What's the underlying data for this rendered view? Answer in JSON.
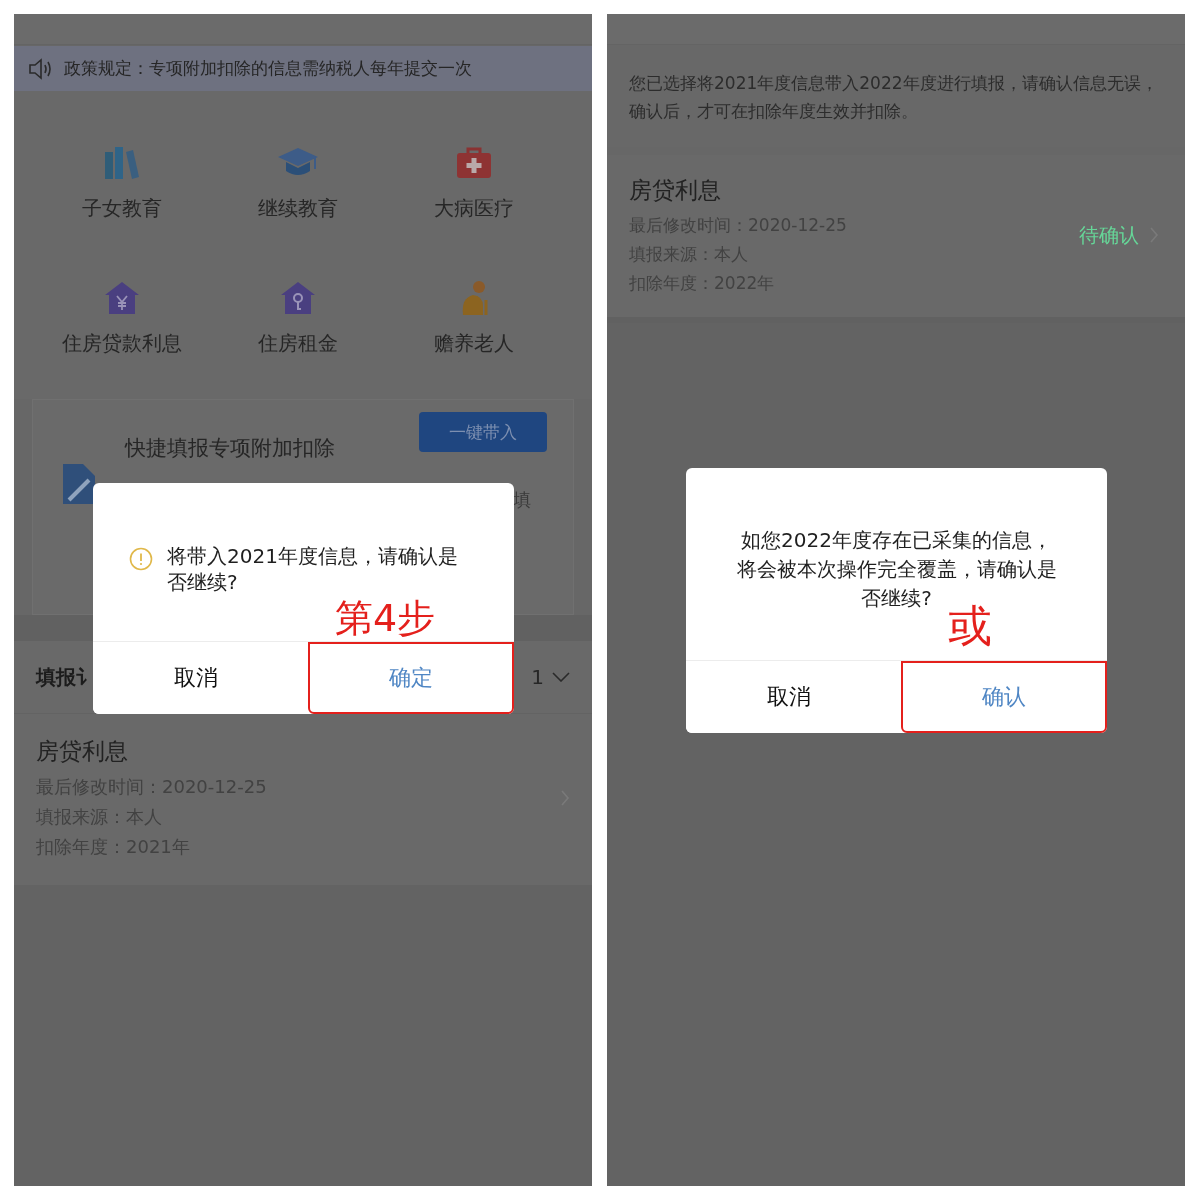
{
  "screen_1": {
    "notice": "政策规定：专项附加扣除的信息需纳税人每年提交一次",
    "categories": [
      {
        "label": "子女教育"
      },
      {
        "label": "继续教育"
      },
      {
        "label": "大病医疗"
      },
      {
        "label": "住房贷款利息"
      },
      {
        "label": "住房租金"
      },
      {
        "label": "赡养老人"
      }
    ],
    "quick_fill": {
      "title": "快捷填报专项附加扣除",
      "button": "一键带入",
      "hint": "填"
    },
    "records_header": {
      "title": "填报讠",
      "year": "1"
    },
    "record": {
      "title": "房贷利息",
      "lines": [
        "最后修改时间：2020-12-25",
        "填报来源：本人",
        "扣除年度：2021年"
      ]
    },
    "dialog": {
      "kind": "warning",
      "message": "将带入2021年度信息，请确认是否继续?",
      "annotation": "第4步",
      "buttons": [
        {
          "label": "取消",
          "primary": false,
          "highlighted": false
        },
        {
          "label": "确定",
          "primary": true,
          "highlighted": true
        }
      ]
    }
  },
  "screen_2": {
    "notice": "您已选择将2021年度信息带入2022年度进行填报，请确认信息无误，确认后，才可在扣除年度生效并扣除。",
    "record": {
      "title": "房贷利息",
      "lines": [
        "最后修改时间：2020-12-25",
        "填报来源：本人",
        "扣除年度：2022年"
      ],
      "status": "待确认"
    },
    "dialog": {
      "kind": "plain",
      "message": "如您2022年度存在已采集的信息，将会被本次操作完全覆盖，请确认是否继续?",
      "annotation": "或",
      "buttons": [
        {
          "label": "取消",
          "primary": false,
          "highlighted": false
        },
        {
          "label": "确认",
          "primary": true,
          "highlighted": true
        }
      ]
    }
  }
}
